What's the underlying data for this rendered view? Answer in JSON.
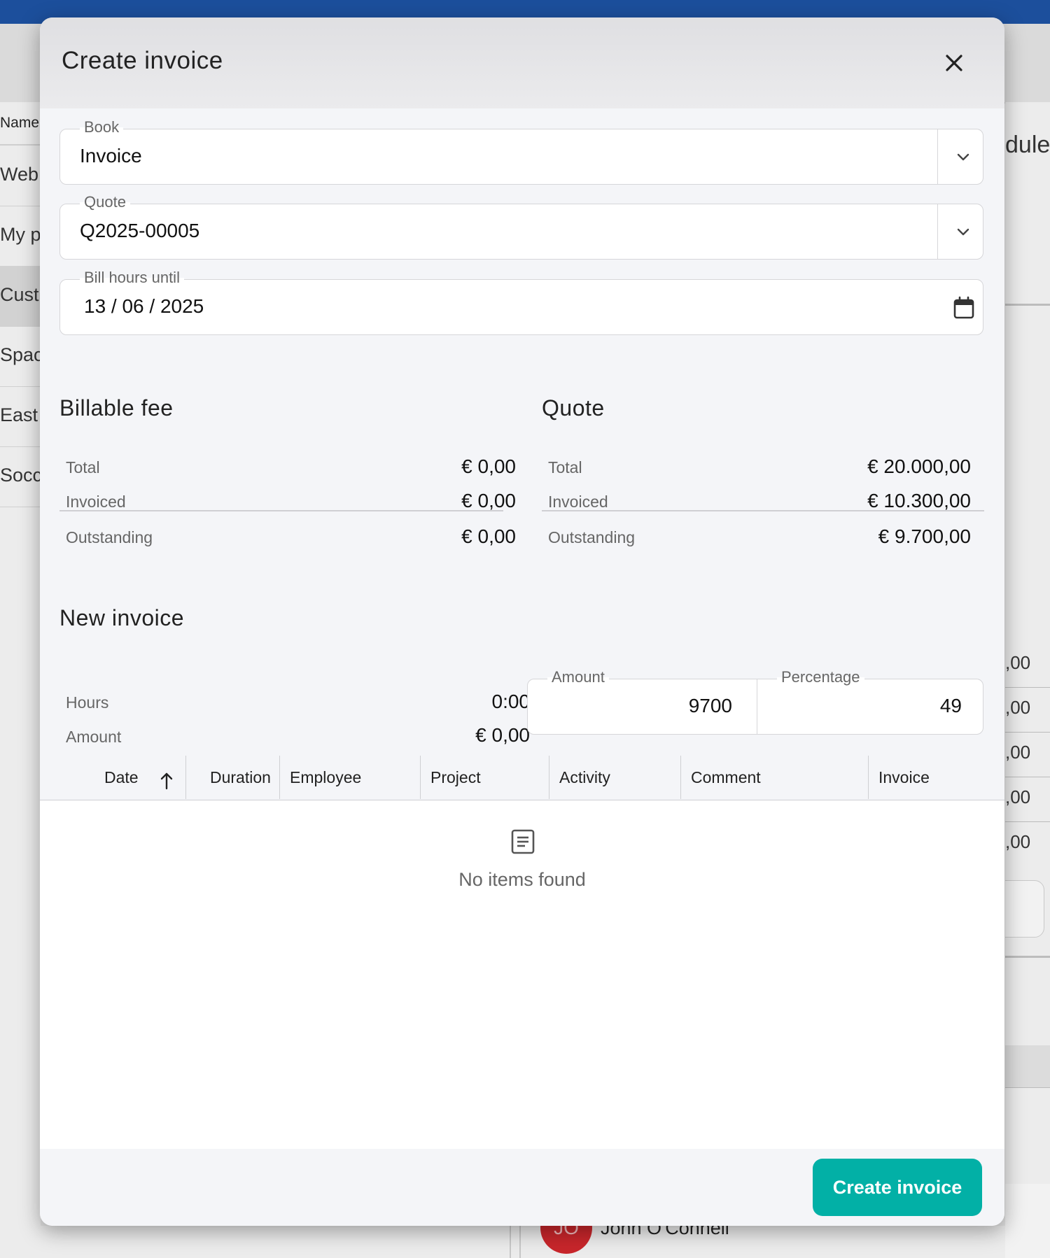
{
  "background": {
    "left_header": "Name",
    "left_rows": [
      {
        "label": "Web"
      },
      {
        "label": "My p"
      },
      {
        "label": "Cust"
      },
      {
        "label": "Spac"
      },
      {
        "label": "East"
      },
      {
        "label": "Socc"
      }
    ],
    "right_heading": "dule",
    "right_values": [
      ",00",
      ",00",
      ",00",
      ",00",
      ",00"
    ],
    "avatar_initials": "JO",
    "avatar_name": "John O'Connell"
  },
  "dialog": {
    "title": "Create invoice",
    "fields": {
      "book": {
        "label": "Book",
        "value": "Invoice"
      },
      "quote": {
        "label": "Quote",
        "value": "Q2025-00005"
      },
      "bill_hours_until": {
        "label": "Bill hours until",
        "value": "13 / 06 / 2025"
      }
    },
    "billable_fee": {
      "title": "Billable fee",
      "total_label": "Total",
      "total": "€ 0,00",
      "invoiced_label": "Invoiced",
      "invoiced": "€ 0,00",
      "outstanding_label": "Outstanding",
      "outstanding": "€ 0,00"
    },
    "quote_summary": {
      "title": "Quote",
      "total_label": "Total",
      "total": "€ 20.000,00",
      "invoiced_label": "Invoiced",
      "invoiced": "€ 10.300,00",
      "outstanding_label": "Outstanding",
      "outstanding": "€ 9.700,00"
    },
    "new_invoice": {
      "title": "New invoice",
      "hours_label": "Hours",
      "hours": "0:00",
      "amount_label": "Amount",
      "amount": "€ 0,00",
      "amount_input_label": "Amount",
      "amount_input_value": "9700",
      "percentage_label": "Percentage",
      "percentage_value": "49"
    },
    "table": {
      "columns": [
        "Date",
        "Duration",
        "Employee",
        "Project",
        "Activity",
        "Comment",
        "Invoice"
      ],
      "empty_text": "No items found"
    },
    "create_button": "Create invoice"
  },
  "colors": {
    "topbar": "#1c4f9c",
    "primary_button": "#02b0a6",
    "avatar": "#c8262b"
  },
  "icons": [
    "close-icon",
    "chevron-down-icon",
    "calendar-icon",
    "arrow-up-icon",
    "document-icon"
  ]
}
